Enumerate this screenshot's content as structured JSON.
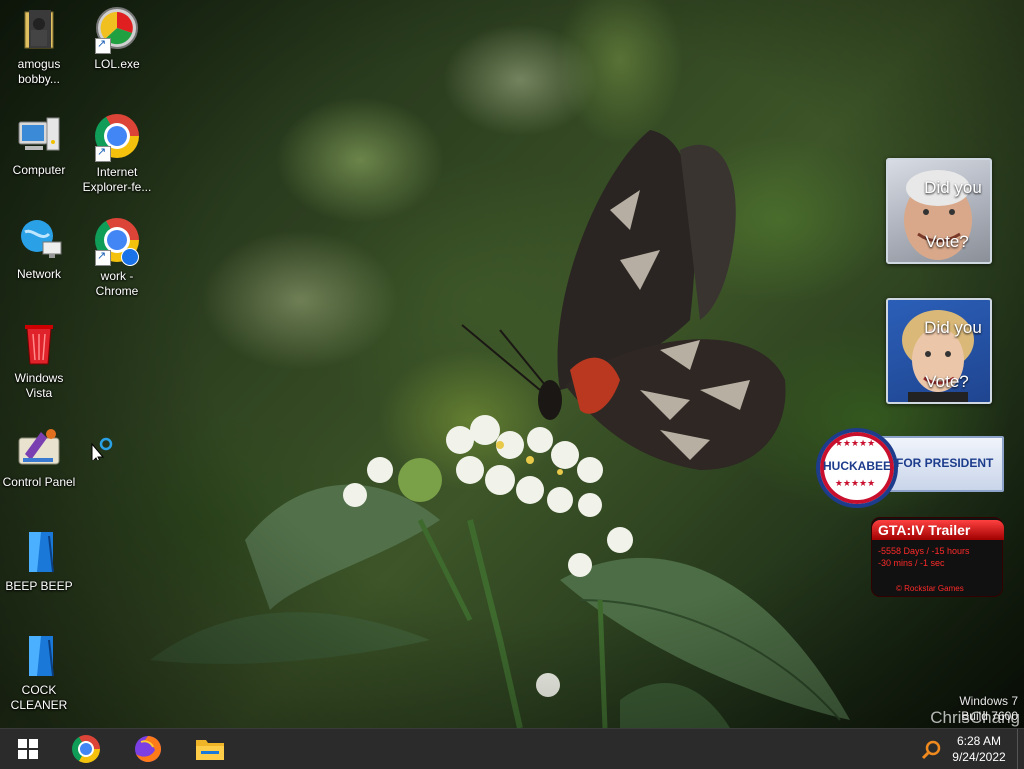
{
  "desktop_icons": [
    {
      "name": "icon-amogus-bobby",
      "line1": "amogus",
      "line2": "bobby..."
    },
    {
      "name": "icon-lol-exe",
      "line1": "LOL.exe",
      "line2": ""
    },
    {
      "name": "icon-computer",
      "line1": "Computer",
      "line2": ""
    },
    {
      "name": "icon-internet-explorer",
      "line1": "Internet",
      "line2": "Explorer-fe..."
    },
    {
      "name": "icon-network",
      "line1": "Network",
      "line2": ""
    },
    {
      "name": "icon-work-chrome",
      "line1": "work -",
      "line2": "Chrome"
    },
    {
      "name": "icon-windows-vista",
      "line1": "Windows",
      "line2": "Vista"
    },
    {
      "name": "icon-control-panel",
      "line1": "Control Panel",
      "line2": ""
    },
    {
      "name": "icon-beep-beep",
      "line1": "BEEP BEEP",
      "line2": ""
    },
    {
      "name": "icon-cock-cleaner",
      "line1": "COCK",
      "line2": "CLEANER"
    }
  ],
  "gadgets": {
    "mccain": {
      "line1": "Did you",
      "line2": "Vote?"
    },
    "clinton": {
      "line1": "Did you",
      "line2": "Vote?"
    },
    "huckabee": {
      "label": "HUCKABEE",
      "suffix": "FOR PRESIDENT"
    },
    "gta": {
      "title": "GTA:IV Trailer",
      "line1": "-5558 Days / -15 hours",
      "line2": "-30 mins / -1 sec",
      "footer": "© Rockstar Games"
    }
  },
  "watermark": {
    "line1": "Windows 7",
    "line2": "Build 7600",
    "author": "ChrisChang"
  },
  "taskbar": {
    "start": "start-button",
    "pinned": [
      "chrome",
      "firefox",
      "file-explorer"
    ],
    "time": "6:28 AM",
    "date": "9/24/2022"
  },
  "colors": {
    "taskbar": "#2b2b2b",
    "huckabee_red": "#c8102e",
    "huckabee_blue": "#1d3c8c",
    "gta_red": "#ff2020"
  }
}
